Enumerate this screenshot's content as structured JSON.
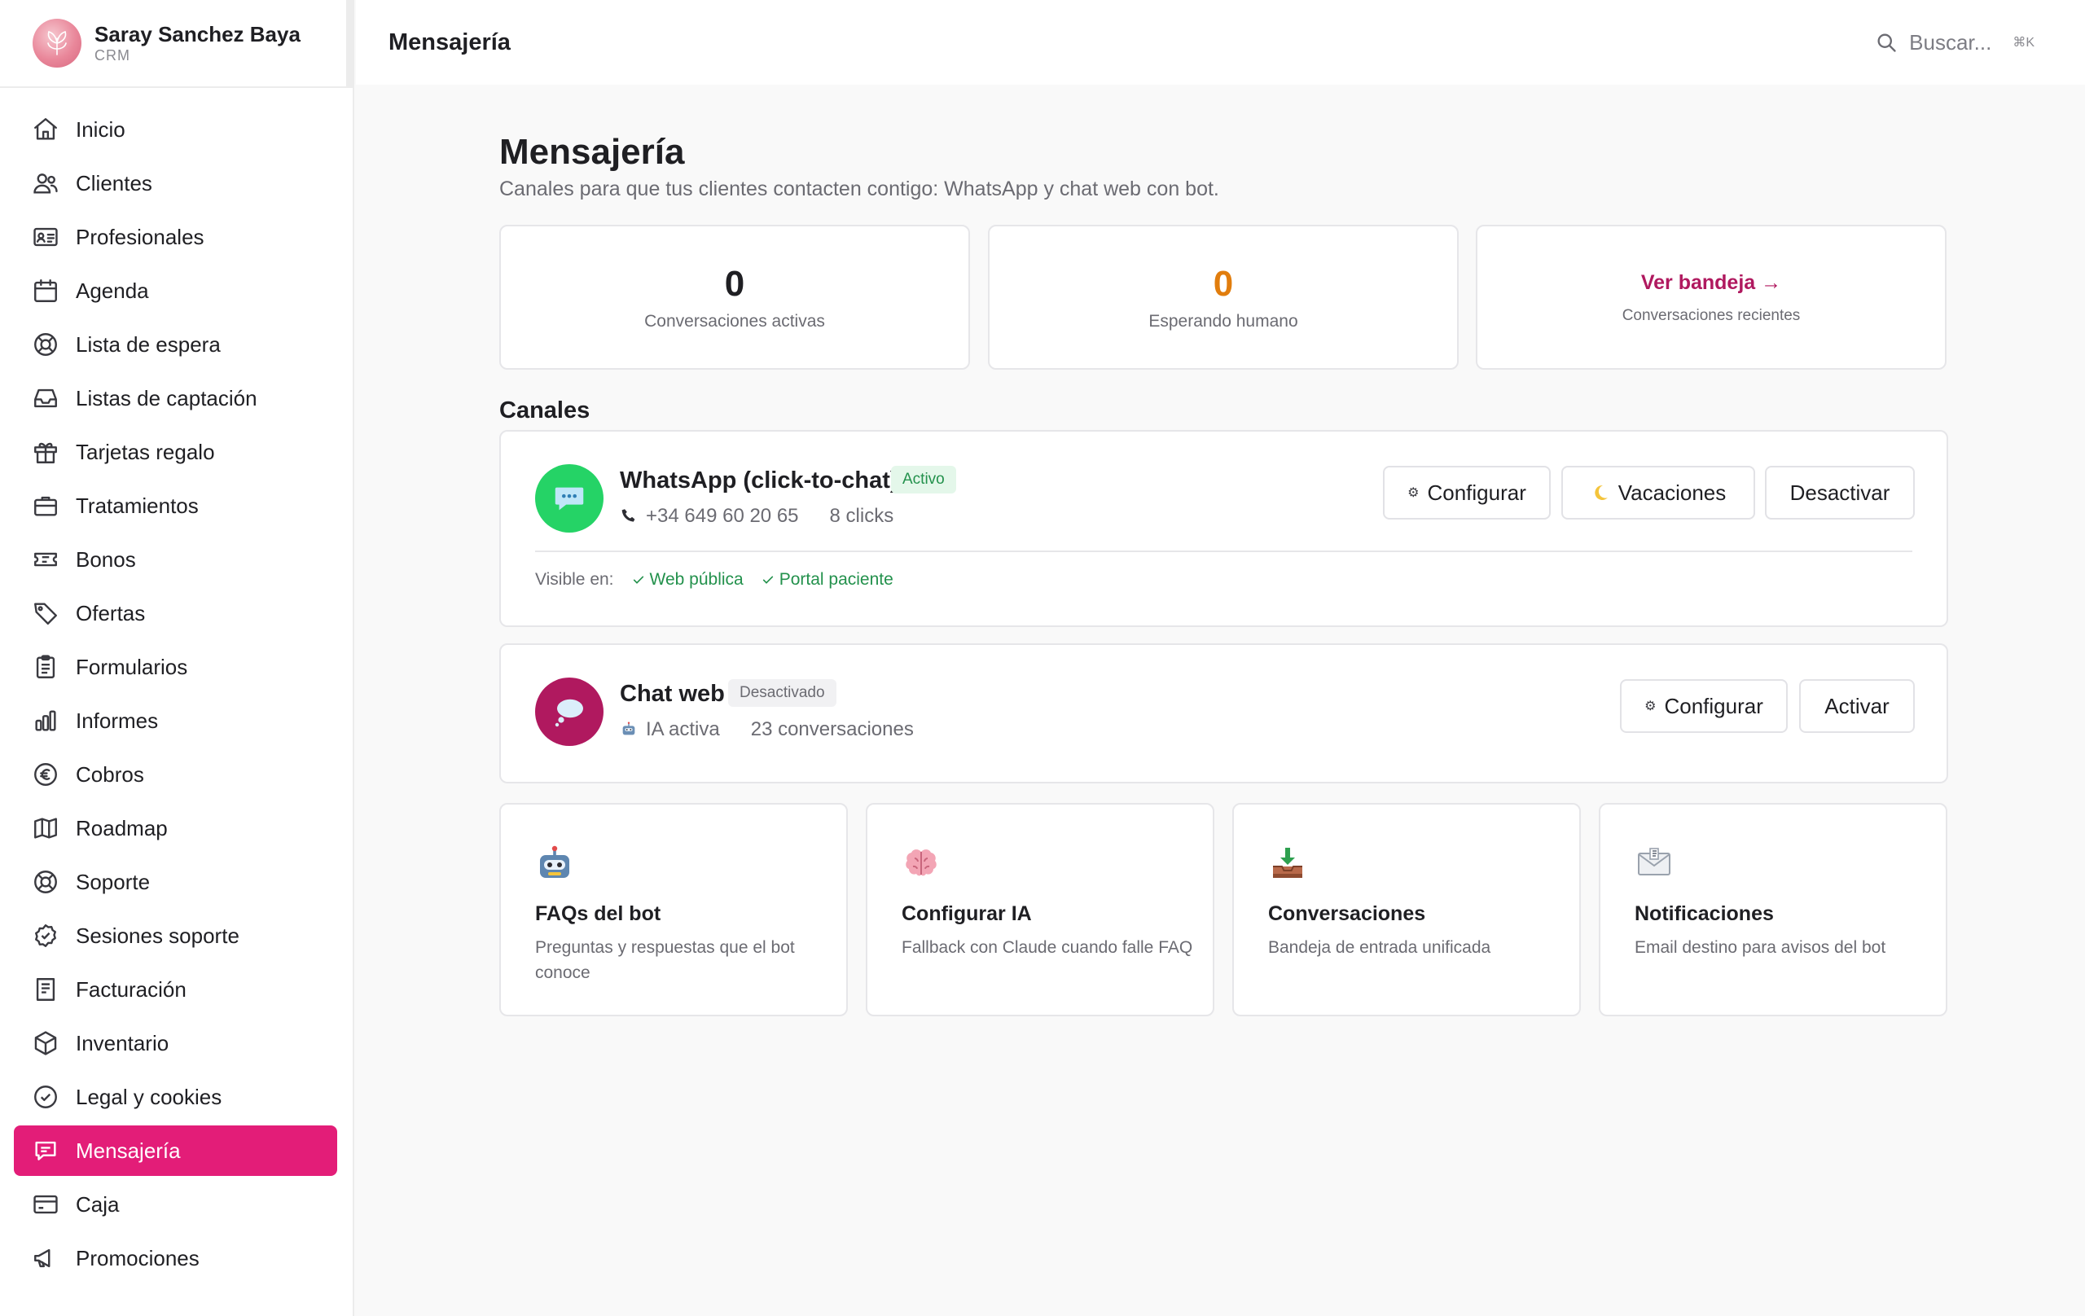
{
  "profile": {
    "name": "Saray Sanchez Baya",
    "subtitle": "CRM"
  },
  "sidebar": {
    "items": [
      {
        "label": "Inicio",
        "icon": "home-icon"
      },
      {
        "label": "Clientes",
        "icon": "users-icon"
      },
      {
        "label": "Profesionales",
        "icon": "id-card-icon"
      },
      {
        "label": "Agenda",
        "icon": "calendar-icon"
      },
      {
        "label": "Lista de espera",
        "icon": "lifebuoy-icon"
      },
      {
        "label": "Listas de captación",
        "icon": "inbox-icon"
      },
      {
        "label": "Tarjetas regalo",
        "icon": "gift-icon"
      },
      {
        "label": "Tratamientos",
        "icon": "briefcase-icon"
      },
      {
        "label": "Bonos",
        "icon": "ticket-icon"
      },
      {
        "label": "Ofertas",
        "icon": "tag-icon"
      },
      {
        "label": "Formularios",
        "icon": "clipboard-icon"
      },
      {
        "label": "Informes",
        "icon": "bar-chart-icon"
      },
      {
        "label": "Cobros",
        "icon": "euro-icon"
      },
      {
        "label": "Roadmap",
        "icon": "map-icon"
      },
      {
        "label": "Soporte",
        "icon": "lifebuoy-icon"
      },
      {
        "label": "Sesiones soporte",
        "icon": "badge-check-icon"
      },
      {
        "label": "Facturación",
        "icon": "receipt-icon"
      },
      {
        "label": "Inventario",
        "icon": "box-icon"
      },
      {
        "label": "Legal y cookies",
        "icon": "shield-check-icon"
      },
      {
        "label": "Mensajería",
        "icon": "chat-icon",
        "active": true
      },
      {
        "label": "Caja",
        "icon": "credit-card-icon"
      },
      {
        "label": "Promociones",
        "icon": "megaphone-icon"
      }
    ]
  },
  "header": {
    "title": "Mensajería",
    "search_placeholder": "Buscar...",
    "shortcut": "⌘K"
  },
  "page": {
    "title": "Mensajería",
    "subtitle": "Canales para que tus clientes contacten contigo: WhatsApp y chat web con bot."
  },
  "stats": {
    "active": {
      "value": "0",
      "label": "Conversaciones activas"
    },
    "waiting": {
      "value": "0",
      "label": "Esperando humano"
    },
    "inbox": {
      "link": "Ver bandeja →",
      "label": "Conversaciones recientes"
    }
  },
  "channels": {
    "section_title": "Canales",
    "whatsapp": {
      "name": "WhatsApp (click-to-chat)",
      "status": "Activo",
      "phone": "+34 649 60 20 65",
      "clicks": "8 clicks",
      "configure": "Configurar",
      "vacation": "Vacaciones",
      "deactivate": "Desactivar",
      "visible_label": "Visible en:",
      "visible_items": [
        "Web pública",
        "Portal paciente"
      ]
    },
    "webchat": {
      "name": "Chat web",
      "status": "Desactivado",
      "ai": "IA activa",
      "conversations": "23 conversaciones",
      "configure": "Configurar",
      "activate": "Activar"
    }
  },
  "cards": [
    {
      "title": "FAQs del bot",
      "desc": "Preguntas y respuestas que el bot conoce",
      "icon": "robot-icon"
    },
    {
      "title": "Configurar IA",
      "desc": "Fallback con Claude cuando falle FAQ",
      "icon": "brain-icon"
    },
    {
      "title": "Conversaciones",
      "desc": "Bandeja de entrada unificada",
      "icon": "inbox-tray-icon"
    },
    {
      "title": "Notificaciones",
      "desc": "Email destino para avisos del bot",
      "icon": "envelope-icon"
    }
  ],
  "colors": {
    "accent": "#e31d78",
    "link": "#b0195f",
    "whatsapp": "#25d366",
    "webchat": "#b0195f",
    "waiting": "#e17d0d",
    "success": "#23914c"
  }
}
